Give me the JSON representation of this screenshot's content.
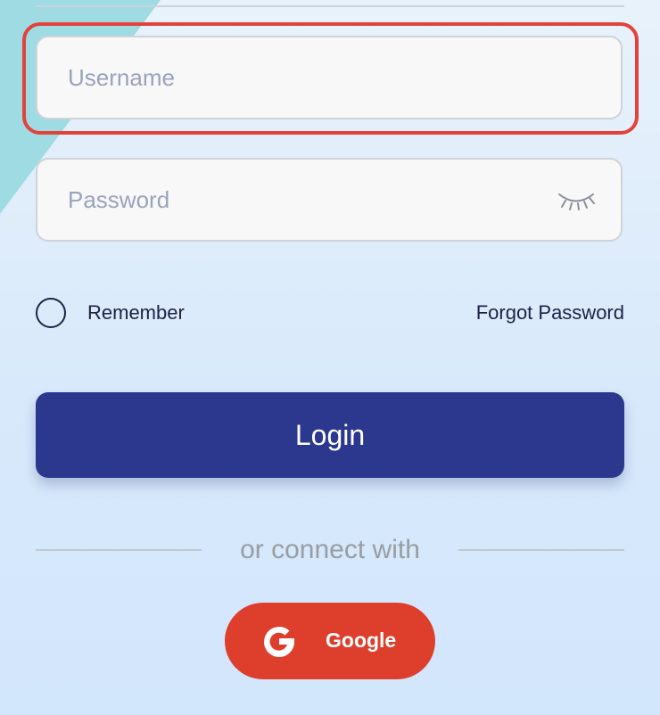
{
  "form": {
    "username": {
      "placeholder": "Username",
      "value": ""
    },
    "password": {
      "placeholder": "Password",
      "value": ""
    },
    "remember_label": "Remember",
    "forgot_label": "Forgot Password",
    "login_label": "Login"
  },
  "social": {
    "divider_text": "or connect with",
    "google_label": "Google"
  },
  "icons": {
    "password_toggle": "eye-closed-icon",
    "google": "google-g-icon"
  },
  "colors": {
    "primary": "#2c378e",
    "google": "#dd3f2c",
    "highlight": "#e3423a",
    "text": "#1c2145"
  }
}
